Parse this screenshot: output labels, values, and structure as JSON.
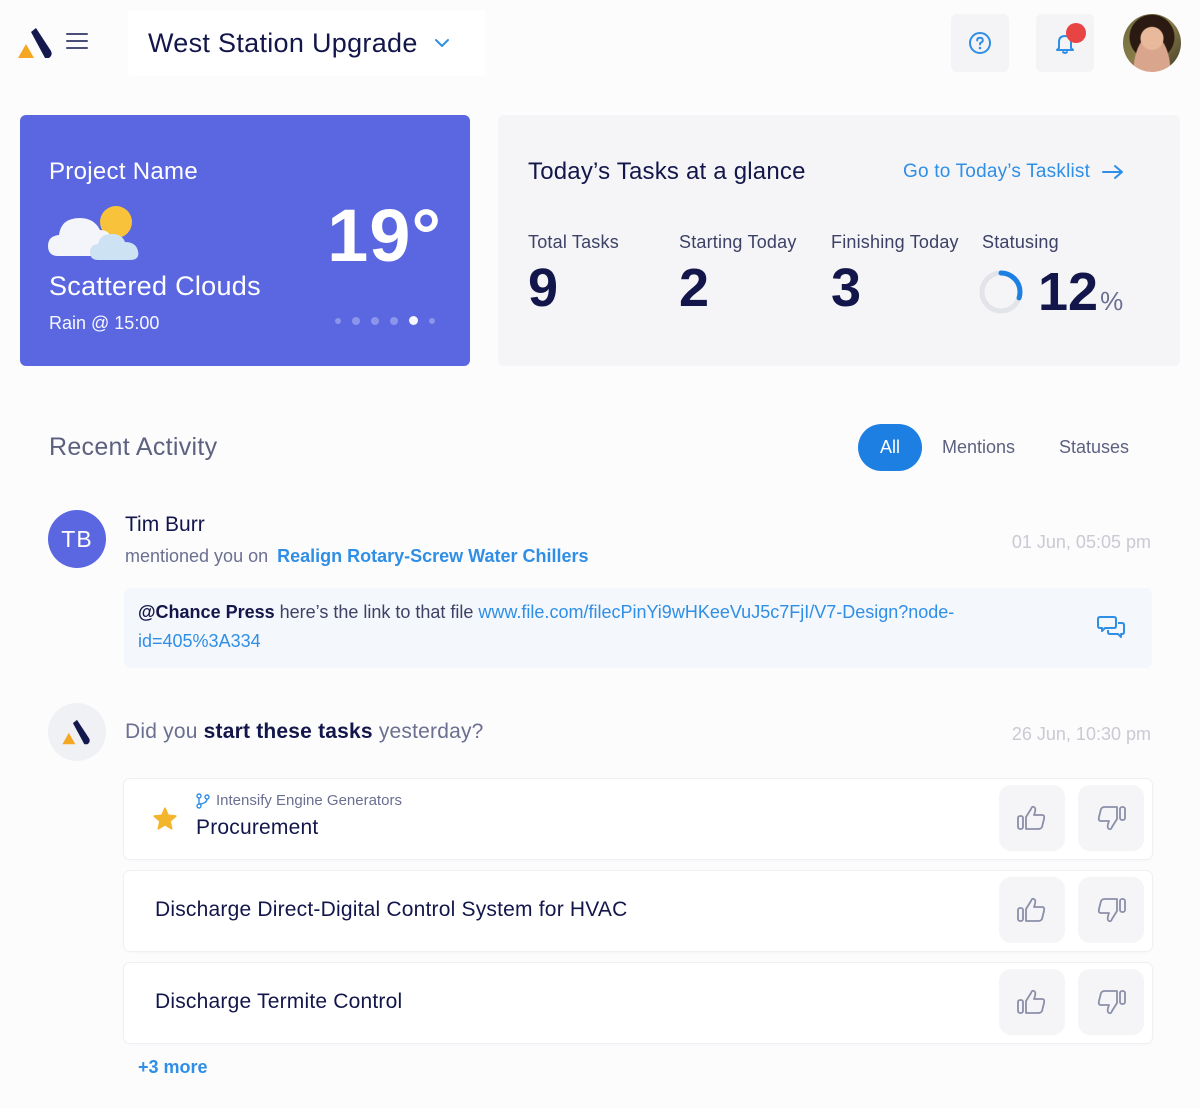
{
  "header": {
    "logo": "app-logo",
    "menu_icon": "hamburger-menu-icon",
    "project_title": "West Station Upgrade",
    "help_icon": "help-circle-icon",
    "notifications_icon": "bell-icon",
    "has_unread_notifications": true,
    "avatar": "user-avatar"
  },
  "weather": {
    "project_label": "Project Name",
    "icon": "partly-cloudy-icon",
    "temperature": "19°",
    "condition": "Scattered Clouds",
    "forecast": "Rain @ 15:00",
    "carousel": {
      "count": 6,
      "active_index": 4
    }
  },
  "tasks": {
    "heading": "Today’s Tasks at a glance",
    "link_label": "Go to Today’s Tasklist",
    "link_icon": "arrow-right-icon",
    "stats": {
      "total": {
        "label": "Total Tasks",
        "value": "9"
      },
      "starting": {
        "label": "Starting Today",
        "value": "2"
      },
      "finishing": {
        "label": "Finishing Today",
        "value": "3"
      },
      "statusing": {
        "label": "Statusing",
        "value": "12",
        "unit": "%",
        "progress_percent": 12
      }
    }
  },
  "activity": {
    "title": "Recent Activity",
    "filters": [
      {
        "label": "All",
        "active": true
      },
      {
        "label": "Mentions",
        "active": false
      },
      {
        "label": "Statuses",
        "active": false
      }
    ],
    "items": [
      {
        "initials": "TB",
        "name": "Tim Burr",
        "action": "mentioned you on",
        "target": "Realign Rotary-Screw Water Chillers",
        "timestamp": "01 Jun, 05:05 pm",
        "comment": {
          "mention": "@Chance Press",
          "text": " here’s the link to that file ",
          "url": "www.file.com/filecPinYi9wHKeeVuJ5c7FjI/V7-Design?node-id=405%3A334"
        },
        "reply_icon": "chat-bubbles-icon"
      },
      {
        "question_prefix": "Did you ",
        "question_bold": "start these tasks",
        "question_suffix": " yesterday?",
        "timestamp": "26 Jun, 10:30 pm",
        "tasks": [
          {
            "parent": "Intensify Engine Generators",
            "name": "Procurement",
            "starred": true
          },
          {
            "name": "Discharge Direct-Digital Control System for HVAC"
          },
          {
            "name": "Discharge Termite Control"
          }
        ],
        "more_label": "+3 more"
      }
    ]
  },
  "colors": {
    "primary_blue": "#1e7fe3",
    "link_blue": "#2f8ee6",
    "weather_card": "#5a67e1",
    "navy_text": "#13164a",
    "star_yellow": "#f2b52c",
    "notification_red": "#e84444"
  }
}
